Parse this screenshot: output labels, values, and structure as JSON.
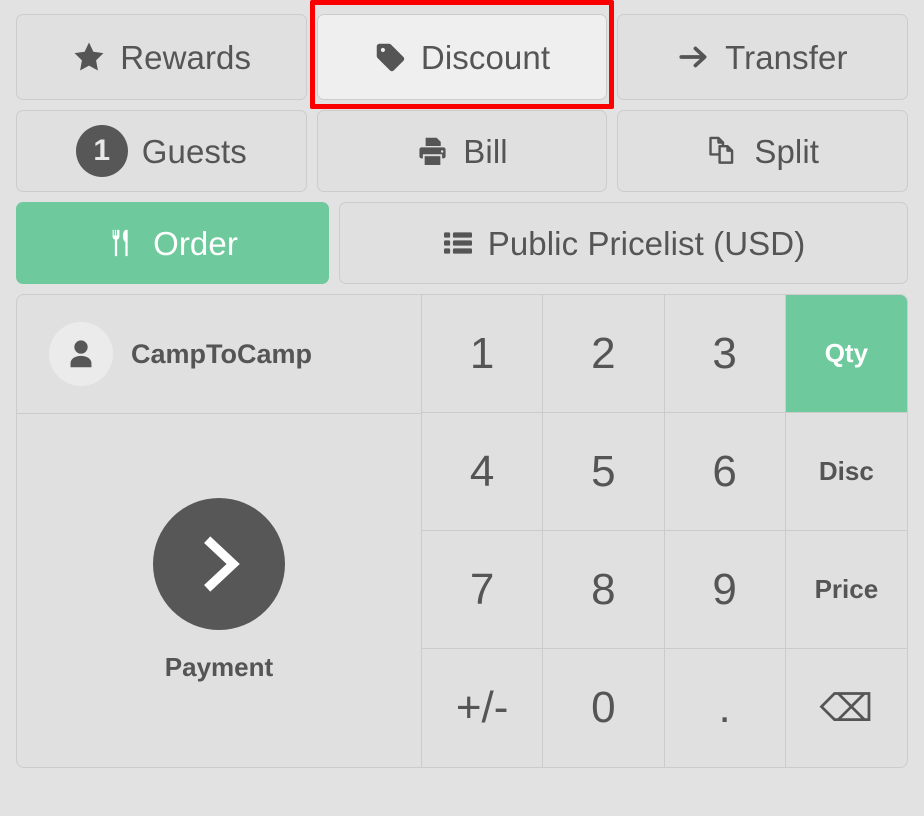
{
  "theme": {
    "background": "#e2e2e2",
    "button_bg": "#e0e0e0",
    "button_border": "#cccccc",
    "accent_green": "#6ec99c",
    "text_dark": "#555555",
    "highlight_red": "#fb0000",
    "dark_circle": "#575757"
  },
  "actions": {
    "row1": [
      {
        "id": "rewards",
        "label": "Rewards",
        "icon": "star-icon",
        "state": "normal"
      },
      {
        "id": "discount",
        "label": "Discount",
        "icon": "tag-icon",
        "state": "hover",
        "highlighted": true
      },
      {
        "id": "transfer",
        "label": "Transfer",
        "icon": "arrow-right-icon",
        "state": "normal"
      }
    ],
    "row2": [
      {
        "id": "guests",
        "label": "Guests",
        "icon": "guest-count-badge",
        "badge": "1",
        "state": "normal"
      },
      {
        "id": "bill",
        "label": "Bill",
        "icon": "printer-icon",
        "state": "normal"
      },
      {
        "id": "split",
        "label": "Split",
        "icon": "copy-pages-icon",
        "state": "normal"
      }
    ],
    "row3": [
      {
        "id": "order",
        "label": "Order",
        "icon": "cutlery-icon",
        "state": "active"
      },
      {
        "id": "pricelist",
        "label": "Public Pricelist (USD)",
        "icon": "list-icon",
        "state": "normal"
      }
    ]
  },
  "panel": {
    "customer": {
      "name": "CampToCamp",
      "icon": "person-avatar-icon"
    },
    "payment": {
      "label": "Payment",
      "icon": "chevron-right-icon"
    },
    "numpad": {
      "keys": [
        {
          "id": "key-1",
          "label": "1",
          "type": "digit",
          "state": "normal"
        },
        {
          "id": "key-2",
          "label": "2",
          "type": "digit",
          "state": "normal"
        },
        {
          "id": "key-3",
          "label": "3",
          "type": "digit",
          "state": "normal"
        },
        {
          "id": "key-qty",
          "label": "Qty",
          "type": "mode",
          "state": "active"
        },
        {
          "id": "key-4",
          "label": "4",
          "type": "digit",
          "state": "normal"
        },
        {
          "id": "key-5",
          "label": "5",
          "type": "digit",
          "state": "normal"
        },
        {
          "id": "key-6",
          "label": "6",
          "type": "digit",
          "state": "normal"
        },
        {
          "id": "key-disc",
          "label": "Disc",
          "type": "mode",
          "state": "normal"
        },
        {
          "id": "key-7",
          "label": "7",
          "type": "digit",
          "state": "normal"
        },
        {
          "id": "key-8",
          "label": "8",
          "type": "digit",
          "state": "normal"
        },
        {
          "id": "key-9",
          "label": "9",
          "type": "digit",
          "state": "normal"
        },
        {
          "id": "key-price",
          "label": "Price",
          "type": "mode",
          "state": "normal"
        },
        {
          "id": "key-sign",
          "label": "+/-",
          "type": "digit",
          "state": "normal"
        },
        {
          "id": "key-0",
          "label": "0",
          "type": "digit",
          "state": "normal"
        },
        {
          "id": "key-dot",
          "label": ".",
          "type": "digit",
          "state": "normal"
        },
        {
          "id": "key-back",
          "label": "⌫",
          "type": "backspace",
          "icon": "backspace-icon",
          "state": "normal"
        }
      ]
    }
  }
}
